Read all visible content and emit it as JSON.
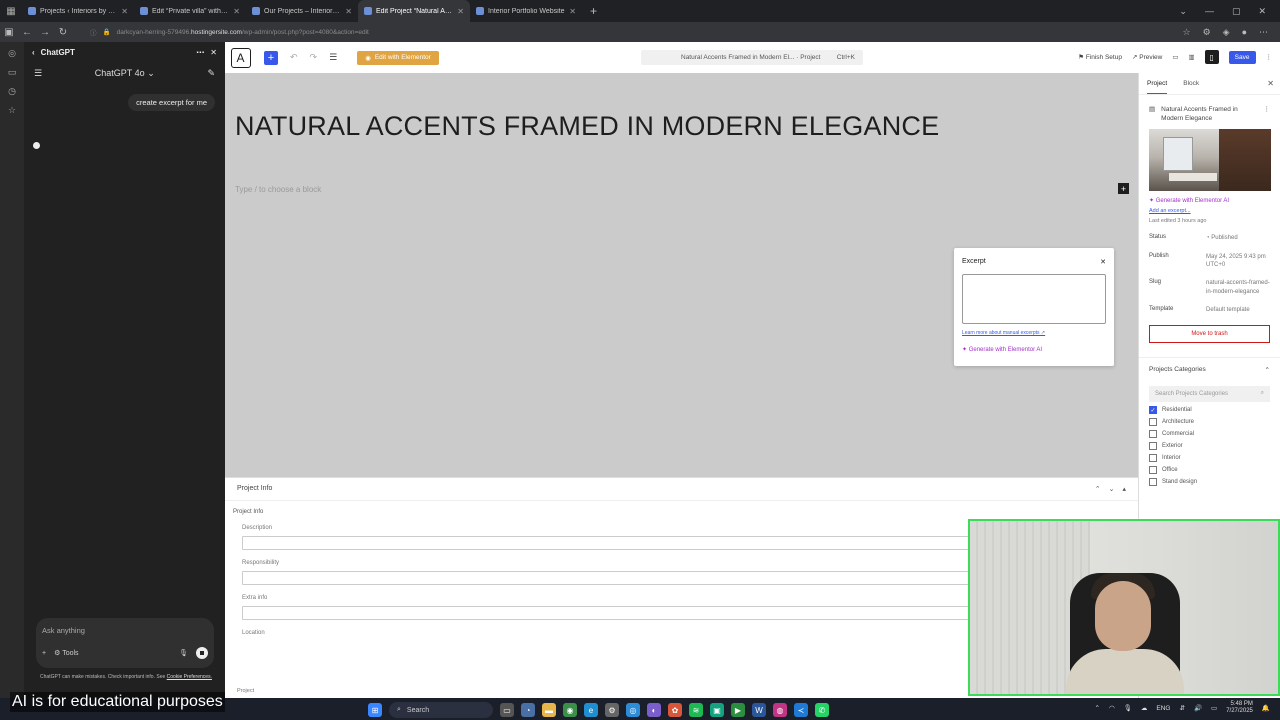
{
  "browser": {
    "tabs": [
      {
        "label": "Projects ‹ Interiors by Guney — ",
        "active": false
      },
      {
        "label": "Edit “Private villa” with Element",
        "active": false
      },
      {
        "label": "Our Projects – Interiors by Gun",
        "active": false
      },
      {
        "label": "Edit Project “Natural Accents F",
        "active": true
      },
      {
        "label": "Interior Portfolio Website",
        "active": false
      }
    ],
    "url_prefix": "darkcyan-herring-579496.",
    "url_host": "hostingersite.com",
    "url_path": "/wp-admin/post.php?post=4080&action=edit"
  },
  "chatgpt": {
    "panel_title": "ChatGPT",
    "model": "ChatGPT 4o",
    "user_message": "create excerpt for me",
    "input_placeholder": "Ask anything",
    "tools_label": "Tools",
    "disclaimer": "ChatGPT can make mistakes. Check important info. See",
    "disclaimer_link": "Cookie Preferences."
  },
  "editor": {
    "elementor_button": "Edit with Elementor",
    "doc_title": "Natural Accents Framed in Modern El... · Project",
    "shortcut": "Ctrl+K",
    "finish_setup": "Finish Setup",
    "preview": "Preview",
    "save": "Save",
    "post_title": "NATURAL ACCENTS FRAMED IN MODERN ELEGANCE",
    "block_hint": "Type / to choose a block"
  },
  "excerpt_popover": {
    "title": "Excerpt",
    "learn_more": "Learn more about manual excerpts ↗",
    "generate": "Generate with Elementor AI"
  },
  "settings": {
    "tab_project": "Project",
    "tab_block": "Block",
    "project_title": "Natural Accents Framed in Modern Elegance",
    "generate": "Generate with Elementor AI",
    "add_excerpt": "Add an excerpt...",
    "last_edited": "Last edited 3 hours ago",
    "status_label": "Status",
    "status_value": "Published",
    "publish_label": "Publish",
    "publish_value": "May 24, 2025 9:43 pm UTC+0",
    "slug_label": "Slug",
    "slug_value": "natural-accents-framed-in-modern-elegance",
    "template_label": "Template",
    "template_value": "Default template",
    "trash": "Move to trash",
    "categories_title": "Projects Categories",
    "categories_search": "Search Projects Categories",
    "categories": [
      {
        "label": "Residential",
        "checked": true
      },
      {
        "label": "Architecture",
        "checked": false
      },
      {
        "label": "Commercial",
        "checked": false
      },
      {
        "label": "Exterior",
        "checked": false
      },
      {
        "label": "Interior",
        "checked": false
      },
      {
        "label": "Office",
        "checked": false
      },
      {
        "label": "Stand design",
        "checked": false
      }
    ]
  },
  "meta_box": {
    "header": "Project Info",
    "subheader": "Project Info",
    "fields": [
      "Description",
      "Responsibility",
      "Extra info",
      "Location"
    ],
    "footer_label": "Project"
  },
  "caption": "AI is for educational purposes",
  "taskbar": {
    "search": "Search",
    "lang": "ENG",
    "time": "5:48 PM",
    "date": "7/27/2025"
  }
}
